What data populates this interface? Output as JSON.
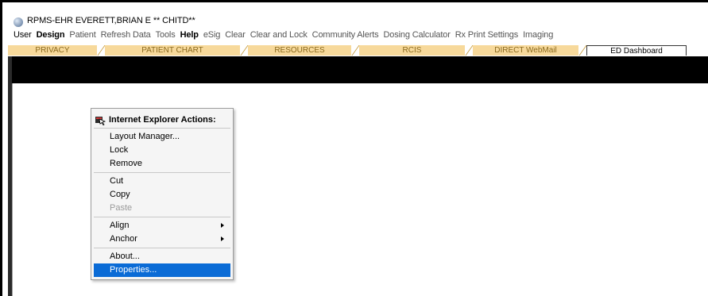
{
  "window": {
    "title": "RPMS-EHR EVERETT,BRIAN E   ** CHITD**"
  },
  "menubar": [
    {
      "label": "User",
      "style": "normal"
    },
    {
      "label": "Design",
      "style": "bold"
    },
    {
      "label": "Patient",
      "style": "dim"
    },
    {
      "label": "Refresh Data",
      "style": "dim"
    },
    {
      "label": "Tools",
      "style": "dim"
    },
    {
      "label": "Help",
      "style": "bold"
    },
    {
      "label": "eSig",
      "style": "dim"
    },
    {
      "label": "Clear",
      "style": "dim"
    },
    {
      "label": "Clear and Lock",
      "style": "dim"
    },
    {
      "label": "Community Alerts",
      "style": "dim"
    },
    {
      "label": "Dosing Calculator",
      "style": "dim"
    },
    {
      "label": "Rx Print Settings",
      "style": "dim"
    },
    {
      "label": "Imaging",
      "style": "dim"
    }
  ],
  "tabs": [
    {
      "label": "PRIVACY"
    },
    {
      "label": "PATIENT CHART"
    },
    {
      "label": "RESOURCES"
    },
    {
      "label": "RCIS"
    },
    {
      "label": "DIRECT WebMail"
    },
    {
      "label": "ED Dashboard",
      "selected": true
    }
  ],
  "context_menu": {
    "header": "Internet Explorer Actions:",
    "header_icon": "ie-actions-icon",
    "items": [
      {
        "label": "Layout Manager..."
      },
      {
        "label": "Lock"
      },
      {
        "label": "Remove"
      },
      {
        "label": "Cut"
      },
      {
        "label": "Copy"
      },
      {
        "label": "Paste",
        "disabled": true
      },
      {
        "label": "Align",
        "submenu": true
      },
      {
        "label": "Anchor",
        "submenu": true
      },
      {
        "label": "About..."
      },
      {
        "label": "Properties...",
        "selected": true
      }
    ],
    "highlight_color": "#0a6bd6"
  }
}
